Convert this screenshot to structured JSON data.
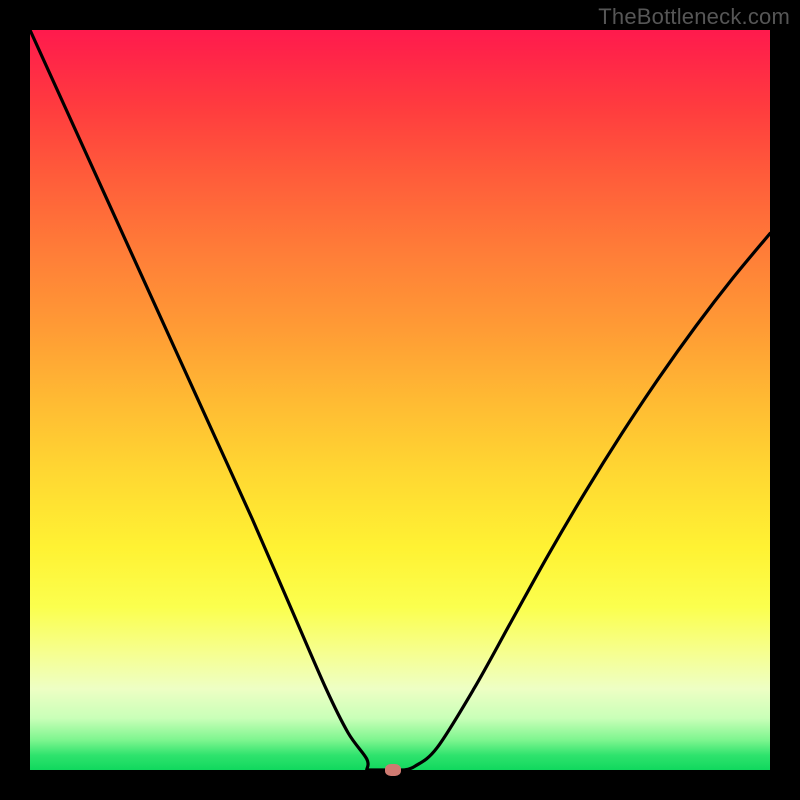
{
  "watermark": "TheBottleneck.com",
  "chart_data": {
    "type": "line",
    "title": "",
    "xlabel": "",
    "ylabel": "",
    "xlim": [
      0,
      1
    ],
    "ylim": [
      0,
      1
    ],
    "gradient_direction": "top-to-bottom",
    "gradient_stops": [
      {
        "pos": 0.0,
        "color": "#ff1a4d"
      },
      {
        "pos": 0.5,
        "color": "#ffba33"
      },
      {
        "pos": 0.75,
        "color": "#fff64a"
      },
      {
        "pos": 1.0,
        "color": "#10d85e"
      }
    ],
    "series": [
      {
        "name": "bottleneck-curve",
        "color": "#000000",
        "stroke_width": 3,
        "x": [
          0.0,
          0.05,
          0.1,
          0.15,
          0.2,
          0.25,
          0.3,
          0.35,
          0.4,
          0.43,
          0.455,
          0.47,
          0.48,
          0.5,
          0.52,
          0.55,
          0.6,
          0.65,
          0.7,
          0.75,
          0.8,
          0.85,
          0.9,
          0.95,
          1.0
        ],
        "y": [
          1.0,
          0.89,
          0.78,
          0.67,
          0.56,
          0.45,
          0.34,
          0.225,
          0.11,
          0.05,
          0.015,
          0.003,
          0.0,
          0.0,
          0.005,
          0.03,
          0.11,
          0.2,
          0.29,
          0.375,
          0.455,
          0.53,
          0.6,
          0.665,
          0.725
        ]
      }
    ],
    "marker": {
      "x": 0.49,
      "y": 0.0,
      "color": "#cf7a71"
    },
    "flat_bottom_range": [
      0.455,
      0.505
    ]
  }
}
